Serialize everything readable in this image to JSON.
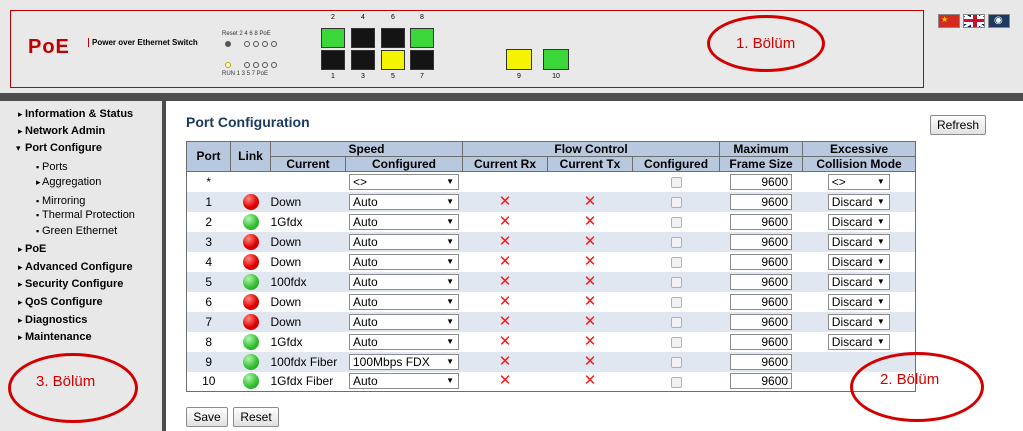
{
  "header": {
    "logo": "PoE",
    "logo_sub": "Power over Ethernet Switch",
    "led_top": "Reset  2  4  6  8  PoE",
    "led_bottom": "RUN  1  3  5  7  PoE",
    "ports_top": [
      "2",
      "4",
      "6",
      "8"
    ],
    "ports_bottom": [
      "1",
      "3",
      "5",
      "7"
    ],
    "sfp_ports": [
      "9",
      "10"
    ],
    "port_colors": {
      "p1": "#141414",
      "p2": "#3ad63a",
      "p3": "#141414",
      "p4": "#141414",
      "p5": "#f4f400",
      "p6": "#141414",
      "p7": "#141414",
      "p8": "#3ad63a",
      "p9": "#f4f400",
      "p10": "#3ad63a"
    },
    "flags": [
      "china-flag-icon",
      "uk-flag-icon",
      "other-flag-icon"
    ]
  },
  "annotations": {
    "a1": "1. Bölüm",
    "a2": "2. Bölüm",
    "a3": "3. Bölüm"
  },
  "sidebar": {
    "items": [
      {
        "label": "Information & Status",
        "arrow": "▸"
      },
      {
        "label": "Network Admin",
        "arrow": "▸"
      },
      {
        "label": "Port Configure",
        "arrow": "▾"
      },
      {
        "label": "PoE",
        "arrow": "▸"
      },
      {
        "label": "Advanced Configure",
        "arrow": "▸"
      },
      {
        "label": "Security Configure",
        "arrow": "▸"
      },
      {
        "label": "QoS Configure",
        "arrow": "▸"
      },
      {
        "label": "Diagnostics",
        "arrow": "▸"
      },
      {
        "label": "Maintenance",
        "arrow": "▸"
      }
    ],
    "sub_items": [
      "Ports",
      "Aggregation",
      "Mirroring",
      "Thermal Protection",
      "Green Ethernet"
    ]
  },
  "main": {
    "title": "Port Configuration",
    "refresh_label": "Refresh",
    "save_label": "Save",
    "reset_label": "Reset"
  },
  "table": {
    "headers": {
      "port": "Port",
      "link": "Link",
      "speed": "Speed",
      "current": "Current",
      "configured": "Configured",
      "flow_control": "Flow Control",
      "current_rx": "Current Rx",
      "current_tx": "Current Tx",
      "fc_configured": "Configured",
      "max_frame_1": "Maximum",
      "max_frame_2": "Frame Size",
      "collision_1": "Excessive",
      "collision_2": "Collision Mode"
    },
    "all_row": {
      "port": "*",
      "speed": "<>",
      "frame": "9600",
      "collision": "<>"
    },
    "rows": [
      {
        "port": "1",
        "link": "red",
        "current": "Down",
        "configured": "Auto",
        "frame": "9600",
        "collision": "Discard"
      },
      {
        "port": "2",
        "link": "green",
        "current": "1Gfdx",
        "configured": "Auto",
        "frame": "9600",
        "collision": "Discard"
      },
      {
        "port": "3",
        "link": "red",
        "current": "Down",
        "configured": "Auto",
        "frame": "9600",
        "collision": "Discard"
      },
      {
        "port": "4",
        "link": "red",
        "current": "Down",
        "configured": "Auto",
        "frame": "9600",
        "collision": "Discard"
      },
      {
        "port": "5",
        "link": "green",
        "current": "100fdx",
        "configured": "Auto",
        "frame": "9600",
        "collision": "Discard"
      },
      {
        "port": "6",
        "link": "red",
        "current": "Down",
        "configured": "Auto",
        "frame": "9600",
        "collision": "Discard"
      },
      {
        "port": "7",
        "link": "red",
        "current": "Down",
        "configured": "Auto",
        "frame": "9600",
        "collision": "Discard"
      },
      {
        "port": "8",
        "link": "green",
        "current": "1Gfdx",
        "configured": "Auto",
        "frame": "9600",
        "collision": "Discard"
      },
      {
        "port": "9",
        "link": "green",
        "current": "100fdx Fiber",
        "configured": "100Mbps FDX",
        "frame": "9600",
        "collision": ""
      },
      {
        "port": "10",
        "link": "green",
        "current": "1Gfdx Fiber",
        "configured": "Auto",
        "frame": "9600",
        "collision": ""
      }
    ],
    "x_mark": "✕"
  }
}
